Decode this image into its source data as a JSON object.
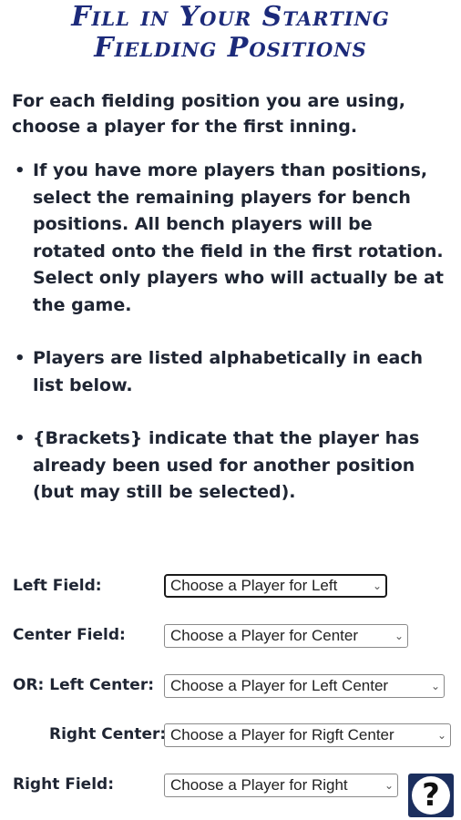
{
  "title": {
    "line1": "Fill in Your Starting",
    "line2": "Fielding Positions"
  },
  "intro": "For each fielding position you are using, choose a player for the first inning.",
  "bullets": [
    "If you have more players than positions, select the remaining players for bench positions. All bench players will be rotated onto the field in the first rotation. Select only players who will actually be at the game.",
    "Players are listed alphabetically in each list below.",
    "{Brackets} indicate that the player has already been used for another position (but may still be selected)."
  ],
  "positions": [
    {
      "label": "Left Field:",
      "placeholder": "Choose a Player for Left"
    },
    {
      "label": "Center Field:",
      "placeholder": "Choose a Player for Center"
    },
    {
      "label": "OR: Left Center:",
      "placeholder": "Choose a Player for Left Center"
    },
    {
      "label": "Right Center:",
      "placeholder": "Choose a Player for Rigft Center"
    },
    {
      "label": "Right Field:",
      "placeholder": "Choose a Player for Right"
    }
  ],
  "help": {
    "icon": "question-icon",
    "glyph": "?"
  },
  "colors": {
    "title": "#1c2a7a",
    "help_bg": "#1c2f5e"
  }
}
